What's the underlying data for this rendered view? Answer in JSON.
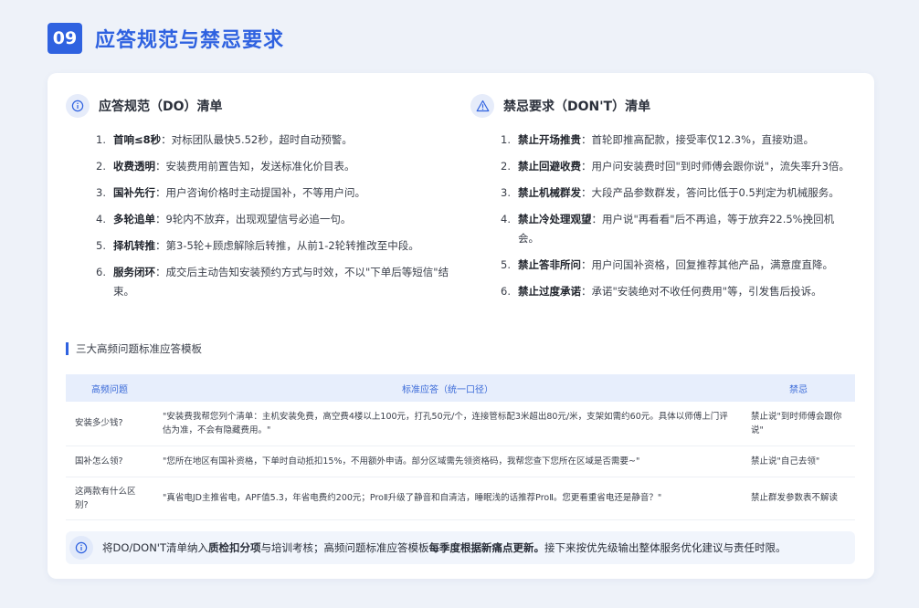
{
  "header": {
    "number": "09",
    "title": "应答规范与禁忌要求"
  },
  "do_list": {
    "title": "应答规范（DO）清单",
    "items": [
      {
        "index": "1.",
        "title": "首响≤8秒",
        "text": "：对标团队最快5.52秒，超时自动预警。"
      },
      {
        "index": "2.",
        "title": "收费透明",
        "text": "：安装费用前置告知，发送标准化价目表。"
      },
      {
        "index": "3.",
        "title": "国补先行",
        "text": "：用户咨询价格时主动提国补，不等用户问。"
      },
      {
        "index": "4.",
        "title": "多轮追单",
        "text": "：9轮内不放弃，出现观望信号必追一句。"
      },
      {
        "index": "5.",
        "title": "择机转推",
        "text": "：第3-5轮+顾虑解除后转推，从前1-2轮转推改至中段。"
      },
      {
        "index": "6.",
        "title": "服务闭环",
        "text": "：成交后主动告知安装预约方式与时效，不以\"下单后等短信\"结束。"
      }
    ]
  },
  "dont_list": {
    "title": "禁忌要求（DON'T）清单",
    "items": [
      {
        "index": "1.",
        "title": "禁止开场推贵",
        "text": "：首轮即推高配款，接受率仅12.3%，直接劝退。"
      },
      {
        "index": "2.",
        "title": "禁止回避收费",
        "text": "：用户问安装费时回\"到时师傅会跟你说\"，流失率升3倍。"
      },
      {
        "index": "3.",
        "title": "禁止机械群发",
        "text": "：大段产品参数群发，答问比低于0.5判定为机械服务。"
      },
      {
        "index": "4.",
        "title": "禁止冷处理观望",
        "text": "：用户说\"再看看\"后不再追，等于放弃22.5%挽回机会。"
      },
      {
        "index": "5.",
        "title": "禁止答非所问",
        "text": "：用户问国补资格，回复推荐其他产品，满意度直降。"
      },
      {
        "index": "6.",
        "title": "禁止过度承诺",
        "text": "：承诺\"安装绝对不收任何费用\"等，引发售后投诉。"
      }
    ]
  },
  "template_section": {
    "label": "三大高频问题标准应答模板",
    "columns": [
      "高频问题",
      "标准应答（统一口径）",
      "禁忌"
    ],
    "rows": [
      {
        "question": "安装多少钱?",
        "answer": "\"安装费我帮您列个清单：主机安装免费，高空费4楼以上100元，打孔50元/个，连接管标配3米超出80元/米，支架如需约60元。具体以师傅上门评估为准，不会有隐藏费用。\"",
        "taboo": "禁止说\"到时师傅会跟你说\""
      },
      {
        "question": "国补怎么领?",
        "answer": "\"您所在地区有国补资格，下单时自动抵扣15%，不用额外申请。部分区域需先领资格码，我帮您查下您所在区域是否需要~\"",
        "taboo": "禁止说\"自己去领\""
      },
      {
        "question": "这两款有什么区别?",
        "answer": "\"真省电JD主推省电，APF值5.3，年省电费约200元；ProⅡ升级了静音和自清洁，睡眠浅的话推荐ProⅡ。您更看重省电还是静音？\"",
        "taboo": "禁止群发参数表不解读"
      }
    ]
  },
  "footer": {
    "segments": [
      {
        "text": "将DO/DON'T清单纳入",
        "bold": false
      },
      {
        "text": "质检扣分项",
        "bold": true
      },
      {
        "text": "与培训考核；高频问题标准应答模板",
        "bold": false
      },
      {
        "text": "每季度根据新痛点更新。",
        "bold": true
      },
      {
        "text": "接下来按优先级输出整体服务优化建议与责任时限。",
        "bold": false
      }
    ]
  },
  "icons": {
    "do": "info-icon",
    "dont": "warning-icon",
    "footer": "info-icon"
  },
  "colors": {
    "accent": "#2f62e0",
    "table_header_bg": "#e7eefc",
    "page_bg": "#eef2f9"
  }
}
